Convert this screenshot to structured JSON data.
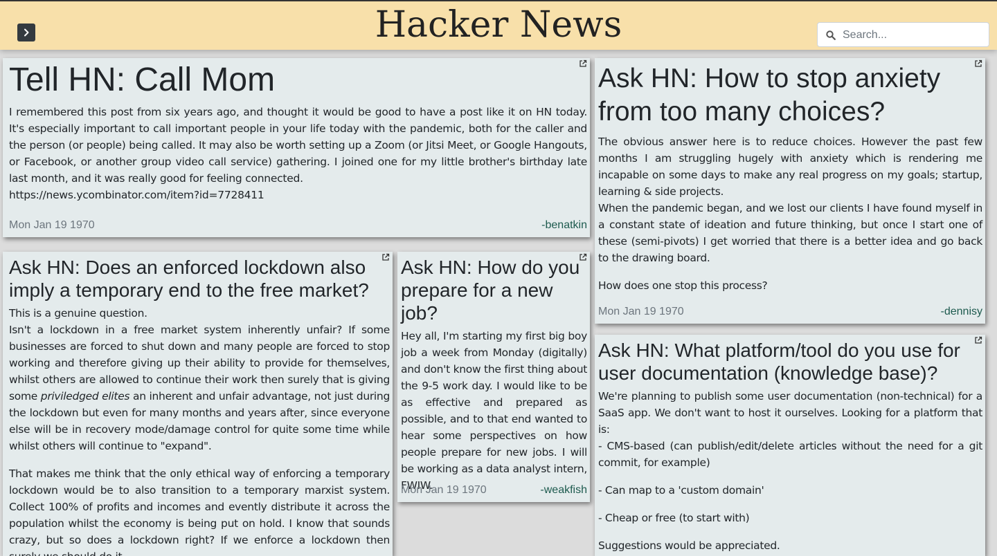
{
  "header": {
    "title": "Hacker News",
    "search_placeholder": "Search..."
  },
  "cards": [
    {
      "title": "Tell HN: Call Mom",
      "p1": "I remembered this post from six years ago, and thought it would be good to have a post like it on HN today. It's especially important to call important people in your life today with the pandemic, both for the caller and the person (or people) being called. It may also be worth setting up a Zoom (or Jitsi Meet, or Google Hangouts, or Facebook, or another group video call service) gathering. I joined one for my little brother's birthday late last month, and it was really good for feeling connected.",
      "p2": "https://news.ycombinator.com/item?id=7728411",
      "date": "Mon Jan 19 1970",
      "author": "-benatkin"
    },
    {
      "title": "Ask HN: How to stop anxiety from too many choices?",
      "p1": "The obvious answer here is to reduce choices. However the past few months I am struggling hugely with anxiety which is rendering me incapable on some days to make any real progress on my goals; startup, learning & side projects.",
      "p2": "When the pandemic began, and we lost our clients I have found myself in a constant state of ideation and future thinking, but once I start one of these (semi-pivots) I get worried that there is a better idea and go back to the drawing board.",
      "p3": "How does one stop this process?",
      "date": "Mon Jan 19 1970",
      "author": "-dennisy"
    },
    {
      "title": "Ask HN: Does an enforced lockdown also imply a temporary end to the free market?",
      "p1": "This is a genuine question.",
      "p2a": "Isn't a lockdown in a free market system inherently unfair? If some businesses are forced to shut down and many people are forced to stop working and therefore giving up their ability to provide for themselves, whilst others are allowed to continue their work then surely that is giving some",
      "p2em": "priviledged elites",
      "p2b": "an inherent and unfair advantage, not just during the lockdown but even for many months and years after, since everyone else will be in recovery mode/damage control for quite some time while whilst others will continue to \"expand\".",
      "p3": "That makes me think that the only ethical way of enforcing a temporary lockdown would be to also transition to a temporary marxist system. Collect 100% of profits and incomes and evently distribute it across the population whilst the economy is being put on hold. I know that sounds crazy, but so does a lockdown right? If we enforce a lockdown then surely we should do it"
    },
    {
      "title": "Ask HN: How do you prepare for a new job?",
      "p1": "Hey all, I'm starting my first big boy job a week from Monday (digitally) and don't know the first thing about the 9-5 work day. I would like to be as effective and prepared as possible, and to that end wanted to hear some perspectives on how people prepare for new jobs. I will be working as a data analyst intern, FWIW.",
      "date": "Mon Jan 19 1970",
      "author": "-weakfish"
    },
    {
      "title": "Ask HN: What platform/tool do you use for user documentation (knowledge base)?",
      "p1": "We're planning to publish some user documentation (non-technical) for a SaaS app. We don't want to host it ourselves. Looking for a platform that is:",
      "p2": "- CMS-based (can publish/edit/delete articles without the need for a git commit, for example)",
      "p3": "- Can map to a 'custom domain'",
      "p4": "- Cheap or free (to start with)",
      "p5": "Suggestions would be appreciated."
    }
  ]
}
